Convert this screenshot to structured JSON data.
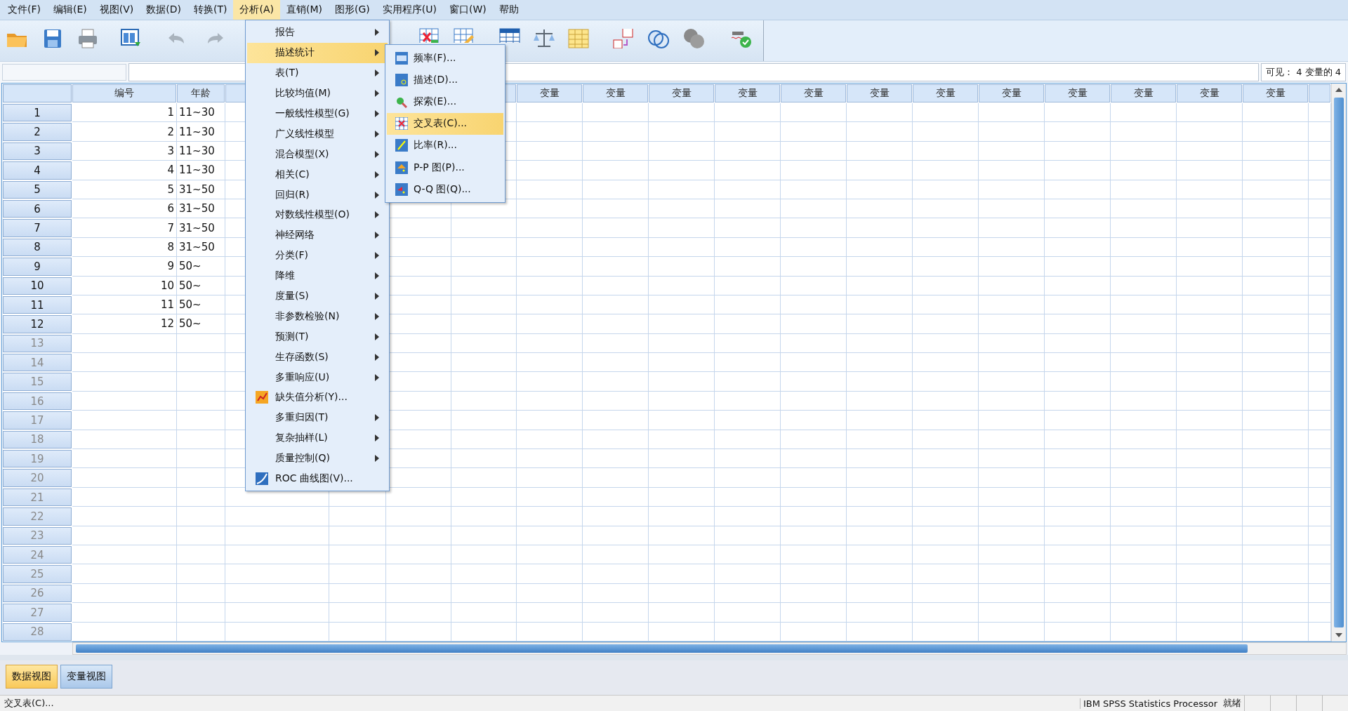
{
  "menubar": [
    {
      "label": "文件(F)",
      "selected": false
    },
    {
      "label": "编辑(E)",
      "selected": false
    },
    {
      "label": "视图(V)",
      "selected": false
    },
    {
      "label": "数据(D)",
      "selected": false
    },
    {
      "label": "转换(T)",
      "selected": false
    },
    {
      "label": "分析(A)",
      "selected": true
    },
    {
      "label": "直销(M)",
      "selected": false
    },
    {
      "label": "图形(G)",
      "selected": false
    },
    {
      "label": "实用程序(U)",
      "selected": false
    },
    {
      "label": "窗口(W)",
      "selected": false
    },
    {
      "label": "帮助",
      "selected": false
    }
  ],
  "visible_count": "可见： 4 变量的 4",
  "grid": {
    "columns": [
      {
        "header": "编号"
      },
      {
        "header": "年龄"
      }
    ],
    "variable_headers": [
      "变量",
      "变量",
      "变量",
      "变量",
      "变量",
      "变量",
      "变量",
      "变量",
      "变量",
      "变量",
      "变量",
      "变量"
    ],
    "rows": [
      {
        "number": "1",
        "cells": [
          "1",
          "11~30"
        ]
      },
      {
        "number": "2",
        "cells": [
          "2",
          "11~30"
        ]
      },
      {
        "number": "3",
        "cells": [
          "3",
          "11~30"
        ]
      },
      {
        "number": "4",
        "cells": [
          "4",
          "11~30"
        ]
      },
      {
        "number": "5",
        "cells": [
          "5",
          "31~50"
        ]
      },
      {
        "number": "6",
        "cells": [
          "6",
          "31~50"
        ]
      },
      {
        "number": "7",
        "cells": [
          "7",
          "31~50"
        ]
      },
      {
        "number": "8",
        "cells": [
          "8",
          "31~50"
        ]
      },
      {
        "number": "9",
        "cells": [
          "9",
          "50~"
        ]
      },
      {
        "number": "10",
        "cells": [
          "10",
          "50~"
        ]
      },
      {
        "number": "11",
        "cells": [
          "11",
          "50~"
        ]
      },
      {
        "number": "12",
        "cells": [
          "12",
          "50~"
        ]
      },
      {
        "number": "13"
      },
      {
        "number": "14"
      },
      {
        "number": "15"
      },
      {
        "number": "16"
      },
      {
        "number": "17"
      },
      {
        "number": "18"
      },
      {
        "number": "19"
      },
      {
        "number": "20"
      },
      {
        "number": "21"
      },
      {
        "number": "22"
      },
      {
        "number": "23"
      },
      {
        "number": "24"
      },
      {
        "number": "25"
      },
      {
        "number": "26"
      },
      {
        "number": "27"
      },
      {
        "number": "28"
      }
    ]
  },
  "menu": {
    "items": [
      {
        "label": "报告",
        "kind": "submenu",
        "selected": false
      },
      {
        "label": "描述统计",
        "kind": "submenu",
        "selected": true
      },
      {
        "label": "表(T)",
        "kind": "submenu",
        "selected": false
      },
      {
        "label": "比较均值(M)",
        "kind": "submenu",
        "selected": false
      },
      {
        "label": "一般线性模型(G)",
        "kind": "submenu",
        "selected": false
      },
      {
        "label": "广义线性模型",
        "kind": "submenu",
        "selected": false
      },
      {
        "label": "混合模型(X)",
        "kind": "submenu",
        "selected": false
      },
      {
        "label": "相关(C)",
        "kind": "submenu",
        "selected": false
      },
      {
        "label": "回归(R)",
        "kind": "submenu",
        "selected": false
      },
      {
        "label": "对数线性模型(O)",
        "kind": "submenu",
        "selected": false
      },
      {
        "label": "神经网络",
        "kind": "submenu",
        "selected": false
      },
      {
        "label": "分类(F)",
        "kind": "submenu",
        "selected": false
      },
      {
        "label": "降维",
        "kind": "submenu",
        "selected": false
      },
      {
        "label": "度量(S)",
        "kind": "submenu",
        "selected": false
      },
      {
        "label": "非参数检验(N)",
        "kind": "submenu",
        "selected": false
      },
      {
        "label": "预测(T)",
        "kind": "submenu",
        "selected": false
      },
      {
        "label": "生存函数(S)",
        "kind": "submenu",
        "selected": false
      },
      {
        "label": "多重响应(U)",
        "kind": "submenu",
        "selected": false
      },
      {
        "label": "缺失值分析(Y)...",
        "kind": "command",
        "selected": false
      },
      {
        "label": "多重归因(T)",
        "kind": "submenu",
        "selected": false
      },
      {
        "label": "复杂抽样(L)",
        "kind": "submenu",
        "selected": false
      },
      {
        "label": "质量控制(Q)",
        "kind": "submenu",
        "selected": false
      },
      {
        "label": "ROC 曲线图(V)...",
        "kind": "command",
        "selected": false
      }
    ]
  },
  "submenu": {
    "items": [
      {
        "label": "频率(F)...",
        "selected": false
      },
      {
        "label": "描述(D)...",
        "selected": false
      },
      {
        "label": "探索(E)...",
        "selected": false
      },
      {
        "label": "交叉表(C)...",
        "selected": true
      },
      {
        "label": "比率(R)...",
        "selected": false
      },
      {
        "label": "P-P 图(P)...",
        "selected": false
      },
      {
        "label": "Q-Q 图(Q)...",
        "selected": false
      }
    ]
  },
  "view_tabs": [
    {
      "label": "数据视图",
      "selected": true
    },
    {
      "label": "变量视图",
      "selected": false
    }
  ],
  "status_bar": {
    "message": "交叉表(C)...",
    "processor": "IBM SPSS Statistics Processor",
    "state": "就绪"
  }
}
